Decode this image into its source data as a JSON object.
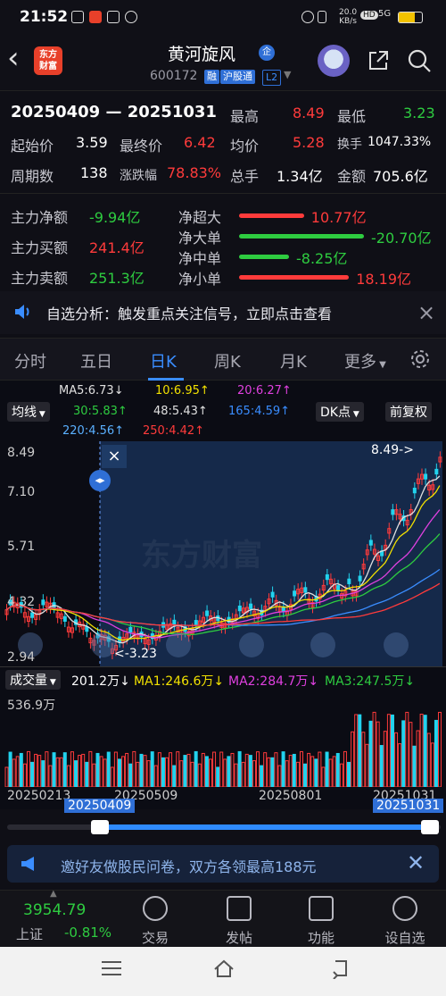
{
  "status": {
    "time": "21:52",
    "net_speed": "20.0",
    "net_unit": "KB/s",
    "hd": "HD",
    "signal": "5G"
  },
  "header": {
    "logo_line1": "东方",
    "logo_line2": "财富",
    "name": "黄河旋风",
    "qi": "企",
    "code": "600172",
    "tags": [
      "融",
      "沪股通",
      "L2"
    ]
  },
  "range": {
    "text": "20250409 — 20251031",
    "high_label": "最高",
    "high": "8.49",
    "low_label": "最低",
    "low": "3.23"
  },
  "stats": [
    {
      "l1": "起始价",
      "v1": "3.59",
      "l2": "最终价",
      "v2": "6.42",
      "l3": "均价",
      "v3": "5.28",
      "l4": "换手",
      "v4": "1047.33%"
    },
    {
      "l1": "周期数",
      "v1": "138",
      "l2": "涨跌幅",
      "v2": "78.83%",
      "l3": "总手",
      "v3": "1.34亿",
      "l4": "金额",
      "v4": "705.6亿"
    }
  ],
  "funds": {
    "main_net_label": "主力净额",
    "main_net": "-9.94亿",
    "main_buy_label": "主力买额",
    "main_buy": "241.4亿",
    "main_sell_label": "主力卖额",
    "main_sell": "251.3亿",
    "rows": [
      {
        "label": "净超大",
        "value": "10.77亿",
        "color": "#ff3b3b",
        "ratio": 0.52
      },
      {
        "label": "净大单",
        "value": "-20.70亿",
        "color": "#2ecc40",
        "ratio": 1.0
      },
      {
        "label": "净中单",
        "value": "-8.25亿",
        "color": "#2ecc40",
        "ratio": 0.4
      },
      {
        "label": "净小单",
        "value": "18.19亿",
        "color": "#ff3b3b",
        "ratio": 0.88
      }
    ]
  },
  "alert": {
    "text": "自选分析：触发重点关注信号，立即点击查看",
    "close": "×"
  },
  "tabs": [
    "分时",
    "五日",
    "日K",
    "周K",
    "月K",
    "更多"
  ],
  "chart": {
    "ma_title": "MA5:6.73↓",
    "ma10": "10:6.95↑",
    "ma20": "20:6.27↑",
    "ma30": "30:5.83↑",
    "ma48": "48:5.43↑",
    "ma165": "165:4.59↑",
    "ma220": "220:4.56↑",
    "ma250": "250:4.42↑",
    "junxian": "均线",
    "dk": "DK点",
    "fuquan": "前复权",
    "y_labels": [
      "8.49",
      "7.10",
      "5.71",
      "4.32",
      "2.94"
    ],
    "max_label": "8.49->",
    "min_label": "<-3.23",
    "watermark": "东方财富"
  },
  "volume": {
    "label": "成交量",
    "v": "201.2万↓",
    "ma1": "MA1:246.6万↓",
    "ma2": "MA2:284.7万↓",
    "ma3": "MA3:247.5万↓",
    "ymax": "536.9万",
    "x_labels": [
      "20250213",
      "20250509",
      "20250801",
      "20251031"
    ],
    "range_start": "20250409",
    "range_end": "20251031"
  },
  "banner": {
    "text": "邀好友做股民问卷，双方各领最高188元"
  },
  "bottom": {
    "index_value": "3954.79",
    "index_name": "上证",
    "index_change": "-0.81%",
    "items": [
      "交易",
      "发帖",
      "功能",
      "设自选"
    ]
  }
}
